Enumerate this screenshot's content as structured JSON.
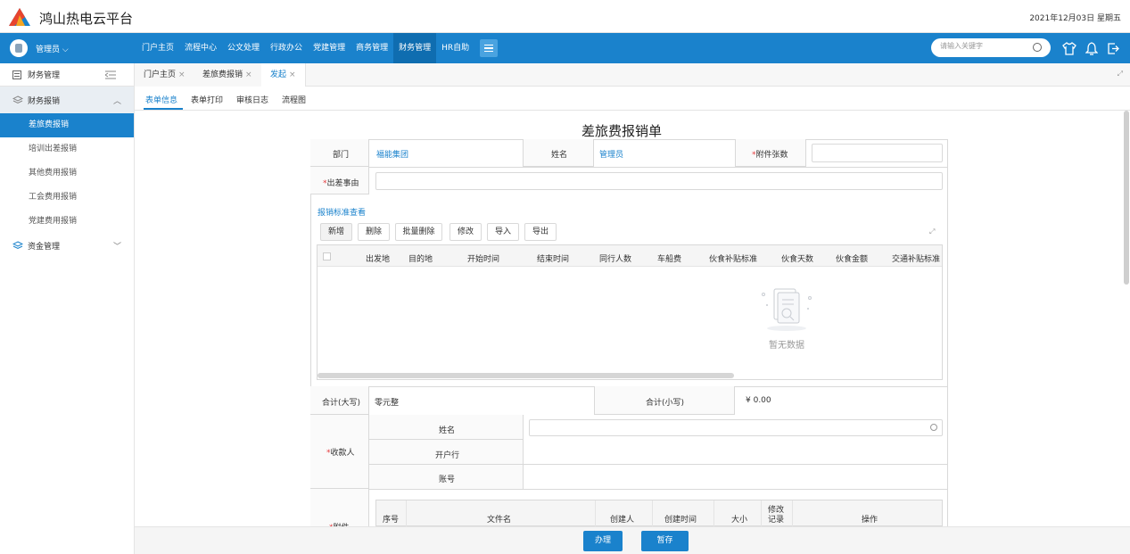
{
  "app": {
    "title": "鸿山热电云平台",
    "date": "2021年12月03日 星期五"
  },
  "user": {
    "name": "管理员"
  },
  "nav": {
    "items": [
      "门户主页",
      "流程中心",
      "公文处理",
      "行政办公",
      "党建管理",
      "商务管理",
      "财务管理",
      "HR自助"
    ],
    "active_index": 6,
    "search_placeholder": "请输入关键字"
  },
  "sidebar": {
    "header": "财务管理",
    "group1": "财务报销",
    "items": [
      "差旅费报销",
      "培训出差报销",
      "其他费用报销",
      "工会费用报销",
      "党建费用报销"
    ],
    "active_index": 0,
    "group2": "资金管理"
  },
  "tabs": [
    "门户主页",
    "差旅费报销",
    "发起"
  ],
  "subtabs": [
    "表单信息",
    "表单打印",
    "审核日志",
    "流程图"
  ],
  "form": {
    "title": "差旅费报销单",
    "dept_label": "部门",
    "dept_value": "福能集团",
    "name_label": "姓名",
    "name_value": "管理员",
    "attach_count_label": "附件张数",
    "reason_label": "出差事由",
    "standard_link": "报销标准查看",
    "buttons": [
      "新增",
      "删除",
      "批量删除",
      "修改",
      "导入",
      "导出"
    ],
    "columns": [
      "出发地",
      "目的地",
      "开始时间",
      "结束时间",
      "同行人数",
      "车船费",
      "伙食补贴标准",
      "伙食天数",
      "伙食金额",
      "交通补贴标准"
    ],
    "empty_text": "暂无数据",
    "total_upper_label": "合计(大写)",
    "total_upper_value": "零元整",
    "total_lower_label": "合计(小写)",
    "total_lower_value": "¥ 0.00",
    "payee_label": "收款人",
    "payee_name_label": "姓名",
    "payee_bank_label": "开户行",
    "payee_account_label": "账号",
    "attach_label": "附件",
    "attach_columns": [
      "序号",
      "文件名",
      "创建人",
      "创建时间",
      "大小",
      "修改记录",
      "操作"
    ]
  },
  "footer": {
    "submit": "办理",
    "save": "暂存"
  },
  "colors": {
    "primary": "#1a82cc",
    "required": "#e4393c"
  }
}
